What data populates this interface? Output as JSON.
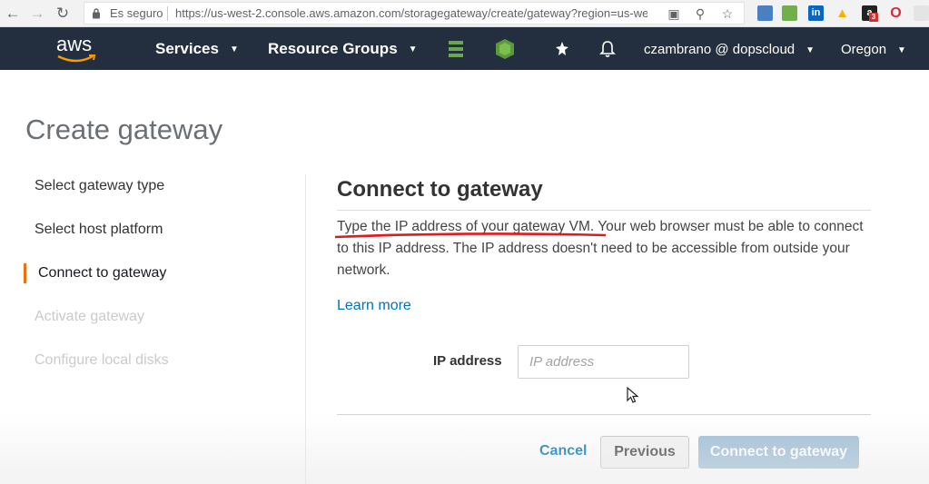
{
  "browser": {
    "secure_label": "Es seguro",
    "url": "https://us-west-2.console.aws.amazon.com/storagegateway/create/gateway?region=us-we...",
    "ext_badge": "3"
  },
  "aws_header": {
    "logo": "aws",
    "services": "Services",
    "resource_groups": "Resource Groups",
    "user": "czambrano @ dopscloud",
    "region": "Oregon",
    "colors": {
      "bg": "#232f3e",
      "accent": "#ff9900"
    }
  },
  "page": {
    "title": "Create gateway",
    "steps": [
      {
        "label": "Select gateway type",
        "state": "done"
      },
      {
        "label": "Select host platform",
        "state": "done"
      },
      {
        "label": "Connect to gateway",
        "state": "active"
      },
      {
        "label": "Activate gateway",
        "state": "future"
      },
      {
        "label": "Configure local disks",
        "state": "future"
      }
    ]
  },
  "section": {
    "title": "Connect to gateway",
    "description": "Type the IP address of your gateway VM. Your web browser must be able to connect to this IP address. The IP address doesn't need to be accessible from outside your network.",
    "learn_more": "Learn more",
    "ip_label": "IP address",
    "ip_placeholder": "IP address",
    "ip_value": ""
  },
  "footer": {
    "cancel": "Cancel",
    "previous": "Previous",
    "connect": "Connect to gateway"
  }
}
